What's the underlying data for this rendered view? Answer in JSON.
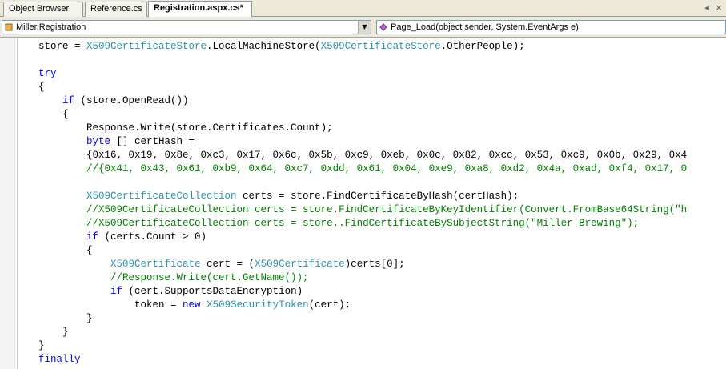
{
  "tabs": [
    {
      "label": "Object Browser",
      "active": false
    },
    {
      "label": "Reference.cs",
      "active": false
    },
    {
      "label": "Registration.aspx.cs*",
      "active": true
    }
  ],
  "tab_controls": {
    "scroll_left": "◂",
    "close": "×"
  },
  "navbar": {
    "class_selector": "Miller.Registration",
    "member_selector": "Page_Load(object sender, System.EventArgs e)",
    "dropdown_glyph": "▼"
  },
  "colors": {
    "keyword": "#0000ff",
    "type": "#2b91af",
    "comment": "#008000"
  },
  "code_lines": [
    {
      "indent": 0,
      "tokens": [
        [
          "t",
          "store = "
        ],
        [
          "ty",
          "X509CertificateStore"
        ],
        [
          "t",
          ".LocalMachineStore("
        ],
        [
          "ty",
          "X509CertificateStore"
        ],
        [
          "t",
          ".OtherPeople);"
        ]
      ]
    },
    {
      "indent": 0,
      "tokens": []
    },
    {
      "indent": 0,
      "tokens": [
        [
          "kw",
          "try"
        ]
      ]
    },
    {
      "indent": 0,
      "tokens": [
        [
          "t",
          "{"
        ]
      ]
    },
    {
      "indent": 1,
      "tokens": [
        [
          "kw",
          "if"
        ],
        [
          "t",
          " (store.OpenRead())"
        ]
      ]
    },
    {
      "indent": 1,
      "tokens": [
        [
          "t",
          "{"
        ]
      ]
    },
    {
      "indent": 2,
      "tokens": [
        [
          "t",
          "Response.Write(store.Certificates.Count);"
        ]
      ]
    },
    {
      "indent": 2,
      "tokens": [
        [
          "kw",
          "byte"
        ],
        [
          "t",
          " [] certHash ="
        ]
      ]
    },
    {
      "indent": 2,
      "tokens": [
        [
          "t",
          "{0x16, 0x19, 0x8e, 0xc3, 0x17, 0x6c, 0x5b, 0xc9, 0xeb, 0x0c, 0x82, 0xcc, 0x53, 0xc9, 0x0b, 0x29, 0x4"
        ]
      ]
    },
    {
      "indent": 2,
      "tokens": [
        [
          "cm",
          "//{0x41, 0x43, 0x61, 0xb9, 0x64, 0xc7, 0xdd, 0x61, 0x04, 0xe9, 0xa8, 0xd2, 0x4a, 0xad, 0xf4, 0x17, 0"
        ]
      ]
    },
    {
      "indent": 0,
      "tokens": []
    },
    {
      "indent": 2,
      "tokens": [
        [
          "ty",
          "X509CertificateCollection"
        ],
        [
          "t",
          " certs = store.FindCertificateByHash(certHash);"
        ]
      ]
    },
    {
      "indent": 2,
      "tokens": [
        [
          "cm",
          "//X509CertificateCollection certs = store.FindCertificateByKeyIdentifier(Convert.FromBase64String(\"h"
        ]
      ]
    },
    {
      "indent": 2,
      "tokens": [
        [
          "cm",
          "//X509CertificateCollection certs = store..FindCertificateBySubjectString(\"Miller Brewing\");"
        ]
      ]
    },
    {
      "indent": 2,
      "tokens": [
        [
          "kw",
          "if"
        ],
        [
          "t",
          " (certs.Count > 0)"
        ]
      ]
    },
    {
      "indent": 2,
      "tokens": [
        [
          "t",
          "{"
        ]
      ]
    },
    {
      "indent": 3,
      "tokens": [
        [
          "ty",
          "X509Certificate"
        ],
        [
          "t",
          " cert = ("
        ],
        [
          "ty",
          "X509Certificate"
        ],
        [
          "t",
          ")certs[0];"
        ]
      ]
    },
    {
      "indent": 3,
      "tokens": [
        [
          "cm",
          "//Response.Write(cert.GetName());"
        ]
      ]
    },
    {
      "indent": 3,
      "tokens": [
        [
          "kw",
          "if"
        ],
        [
          "t",
          " (cert.SupportsDataEncryption)"
        ]
      ]
    },
    {
      "indent": 4,
      "tokens": [
        [
          "t",
          "token = "
        ],
        [
          "kw",
          "new"
        ],
        [
          "t",
          " "
        ],
        [
          "ty",
          "X509SecurityToken"
        ],
        [
          "t",
          "(cert);"
        ]
      ]
    },
    {
      "indent": 2,
      "tokens": [
        [
          "t",
          "}"
        ]
      ]
    },
    {
      "indent": 1,
      "tokens": [
        [
          "t",
          "}"
        ]
      ]
    },
    {
      "indent": 0,
      "tokens": [
        [
          "t",
          "}"
        ]
      ]
    },
    {
      "indent": 0,
      "tokens": [
        [
          "kw",
          "finally"
        ]
      ]
    }
  ]
}
